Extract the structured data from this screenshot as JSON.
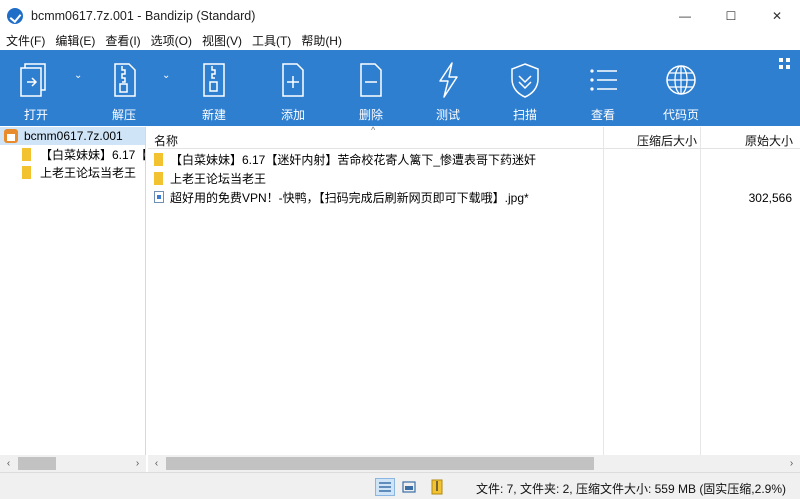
{
  "window": {
    "title": "bcmm0617.7z.001 - Bandizip (Standard)",
    "minimize": "—",
    "maximize": "☐",
    "close": "✕"
  },
  "menu": [
    "文件(F)",
    "编辑(E)",
    "查看(I)",
    "选项(O)",
    "视图(V)",
    "工具(T)",
    "帮助(H)"
  ],
  "toolbar": {
    "open": "打开",
    "extract": "解压",
    "new": "新建",
    "add": "添加",
    "delete": "删除",
    "test": "测试",
    "scan": "扫描",
    "view": "查看",
    "codepage": "代码页",
    "dropdown_arrow": "⌄"
  },
  "tree": {
    "root": "bcmm0617.7z.001",
    "items": [
      "【白菜妹妹】6.17【",
      "上老王论坛当老王"
    ]
  },
  "list": {
    "columns": {
      "name": "名称",
      "packed": "压缩后大小",
      "size": "原始大小"
    },
    "sort_indicator": "^",
    "rows": [
      {
        "name": "【白菜妹妹】6.17【迷奸内射】苦命校花寄人篱下_惨遭表哥下药迷奸",
        "packed": "",
        "size": "",
        "type": "folder"
      },
      {
        "name": "上老王论坛当老王",
        "packed": "",
        "size": "",
        "type": "folder"
      },
      {
        "name": "超好用的免费VPN！-快鸭，【扫码完成后刷新网页即可下载哦】.jpg*",
        "packed": "",
        "size": "302,566",
        "type": "file"
      }
    ]
  },
  "scroll": {
    "left": "‹",
    "right": "›"
  },
  "status": "文件: 7, 文件夹: 2, 压缩文件大小: 559 MB (固实压缩,2.9%)",
  "colors": {
    "toolbar": "#2f7fd1",
    "selection": "#cfe4f7",
    "folder": "#f2c230"
  }
}
